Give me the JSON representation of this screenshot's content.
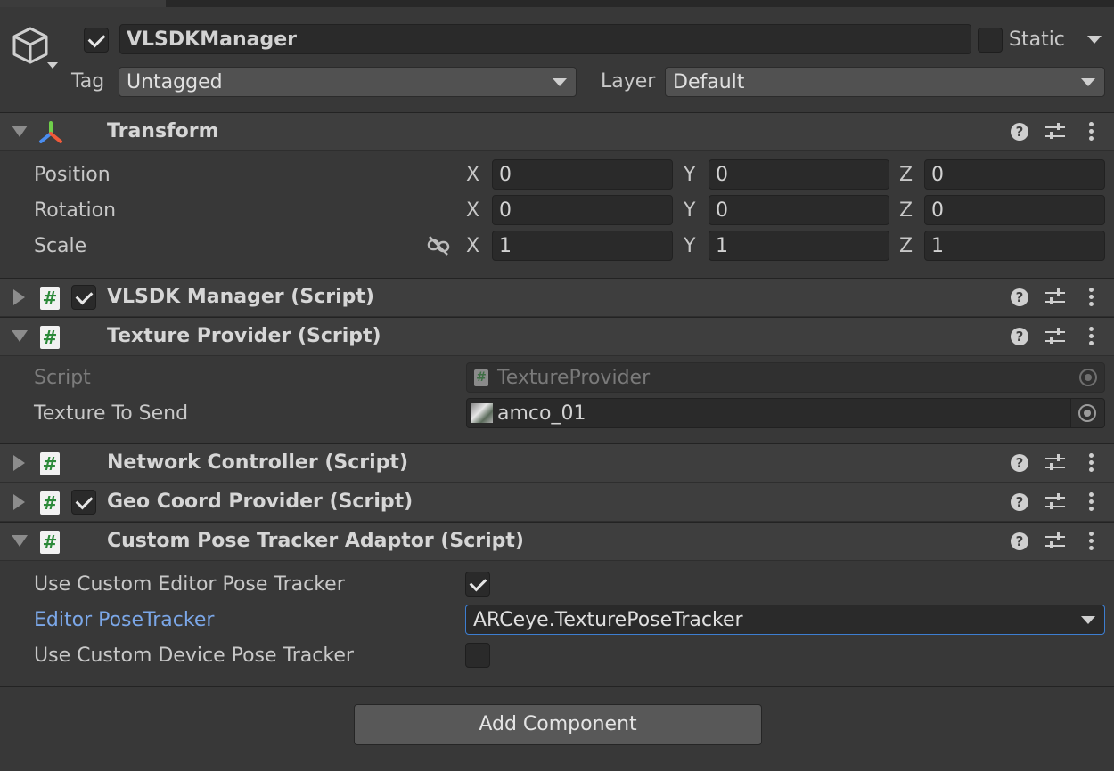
{
  "gameobject": {
    "name": "VLSDKManager",
    "active": true,
    "static_label": "Static",
    "static_checked": false,
    "tag_label": "Tag",
    "tag_value": "Untagged",
    "layer_label": "Layer",
    "layer_value": "Default"
  },
  "transform": {
    "title": "Transform",
    "position_label": "Position",
    "rotation_label": "Rotation",
    "scale_label": "Scale",
    "axis_x": "X",
    "axis_y": "Y",
    "axis_z": "Z",
    "position": {
      "x": "0",
      "y": "0",
      "z": "0"
    },
    "rotation": {
      "x": "0",
      "y": "0",
      "z": "0"
    },
    "scale": {
      "x": "1",
      "y": "1",
      "z": "1"
    }
  },
  "components": {
    "vlsdk_manager": {
      "title": "VLSDK Manager (Script)",
      "enabled": true
    },
    "texture_provider": {
      "title": "Texture Provider (Script)",
      "script_label": "Script",
      "script_value": "TextureProvider",
      "texture_label": "Texture To Send",
      "texture_value": "amco_01"
    },
    "network_controller": {
      "title": "Network Controller (Script)"
    },
    "geo_coord_provider": {
      "title": "Geo Coord Provider (Script)",
      "enabled": true
    },
    "custom_pose_tracker": {
      "title": "Custom Pose Tracker Adaptor (Script)",
      "use_editor_label": "Use Custom Editor Pose Tracker",
      "use_editor_checked": true,
      "editor_tracker_label": "Editor PoseTracker",
      "editor_tracker_value": "ARCeye.TexturePoseTracker",
      "use_device_label": "Use Custom Device Pose Tracker",
      "use_device_checked": false
    }
  },
  "add_component_label": "Add Component",
  "colors": {
    "accent": "#3d7ed1",
    "label_blue": "#7ba7e8",
    "script_icon_green": "#2c8a3a"
  },
  "icons": [
    "gameobject-cube-icon",
    "transform-axes-icon",
    "script-hash-icon",
    "help-icon",
    "presets-icon",
    "kebab-menu-icon",
    "unlink-icon",
    "object-picker-icon",
    "texture-thumbnail-icon"
  ]
}
